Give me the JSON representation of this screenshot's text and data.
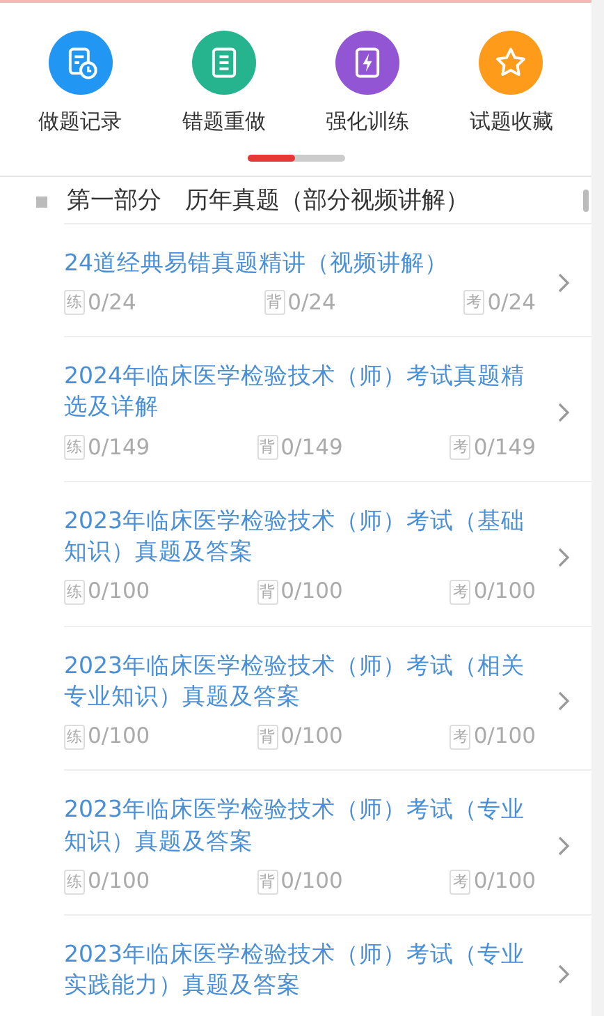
{
  "shortcuts": [
    {
      "label": "做题记录",
      "kind": "record",
      "color": "#2196f3"
    },
    {
      "label": "错题重做",
      "kind": "notebook",
      "color": "#26b48f"
    },
    {
      "label": "强化训练",
      "kind": "bolt",
      "color": "#9255d3"
    },
    {
      "label": "试题收藏",
      "kind": "star",
      "color": "#ff9b1a"
    }
  ],
  "section": {
    "title": "第一部分　历年真题（部分视频讲解）"
  },
  "items": [
    {
      "title": "24道经典易错真题精讲（视频讲解）",
      "stats": [
        {
          "tag": "练",
          "value": "0/24"
        },
        {
          "tag": "背",
          "value": "0/24"
        },
        {
          "tag": "考",
          "value": "0/24"
        }
      ]
    },
    {
      "title": "2024年临床医学检验技术（师）考试真题精选及详解",
      "stats": [
        {
          "tag": "练",
          "value": "0/149"
        },
        {
          "tag": "背",
          "value": "0/149"
        },
        {
          "tag": "考",
          "value": "0/149"
        }
      ]
    },
    {
      "title": "2023年临床医学检验技术（师）考试（基础知识）真题及答案",
      "stats": [
        {
          "tag": "练",
          "value": "0/100"
        },
        {
          "tag": "背",
          "value": "0/100"
        },
        {
          "tag": "考",
          "value": "0/100"
        }
      ]
    },
    {
      "title": "2023年临床医学检验技术（师）考试（相关专业知识）真题及答案",
      "stats": [
        {
          "tag": "练",
          "value": "0/100"
        },
        {
          "tag": "背",
          "value": "0/100"
        },
        {
          "tag": "考",
          "value": "0/100"
        }
      ]
    },
    {
      "title": "2023年临床医学检验技术（师）考试（专业知识）真题及答案",
      "stats": [
        {
          "tag": "练",
          "value": "0/100"
        },
        {
          "tag": "背",
          "value": "0/100"
        },
        {
          "tag": "考",
          "value": "0/100"
        }
      ]
    },
    {
      "title": "2023年临床医学检验技术（师）考试（专业实践能力）真题及答案"
    }
  ]
}
